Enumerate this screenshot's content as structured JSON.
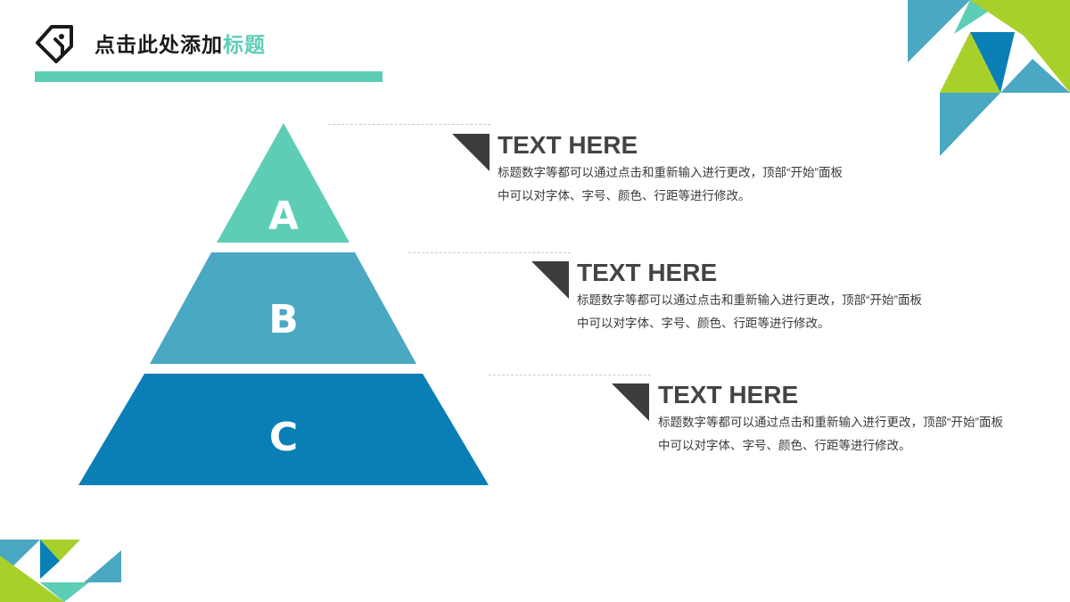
{
  "header": {
    "title_main": "点击此处添加",
    "title_accent": "标题"
  },
  "pyramid": {
    "levels": [
      {
        "label": "A",
        "color": "#5ecdb5"
      },
      {
        "label": "B",
        "color": "#4aa8c2"
      },
      {
        "label": "C",
        "color": "#0a7fb6"
      }
    ]
  },
  "items": [
    {
      "heading": "TEXT HERE",
      "body": "标题数字等都可以通过点击和重新输入进行更改，顶部“开始”面板中可以对字体、字号、颜色、行距等进行修改。"
    },
    {
      "heading": "TEXT HERE",
      "body": "标题数字等都可以通过点击和重新输入进行更改，顶部“开始”面板中可以对字体、字号、颜色、行距等进行修改。"
    },
    {
      "heading": "TEXT HERE",
      "body": "标题数字等都可以通过点击和重新输入进行更改，顶部“开始”面板中可以对字体、字号、颜色、行距等进行修改。"
    }
  ],
  "colors": {
    "teal": "#5ecdb5",
    "light_blue": "#4aa8c2",
    "deep_blue": "#0a7fb6",
    "lime": "#a8d02a",
    "dark_gray": "#3d3d3d"
  }
}
